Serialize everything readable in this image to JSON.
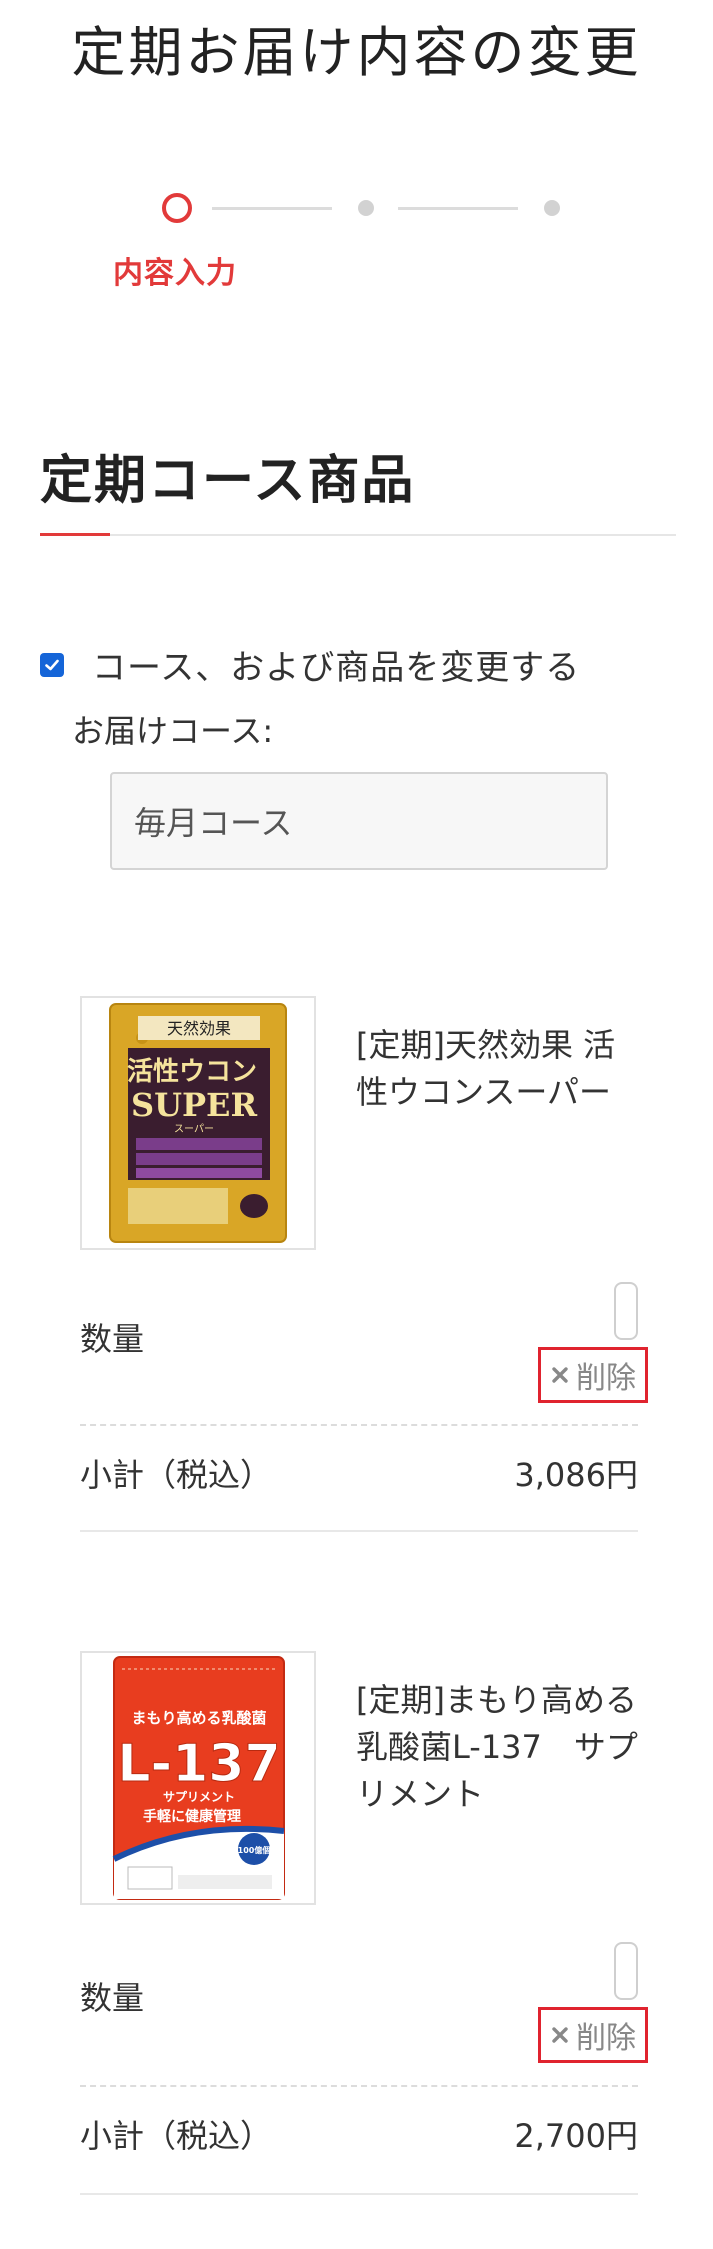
{
  "page": {
    "title": "定期お届け内容の変更"
  },
  "stepper": {
    "current_label": "内容入力"
  },
  "section": {
    "title": "定期コース商品"
  },
  "change": {
    "label": "コース、および商品を変更する",
    "checked": true
  },
  "course": {
    "label": "お届けコース:",
    "value": "毎月コース"
  },
  "products": [
    {
      "name": "[定期]天然効果 活性ウコンスーパー",
      "qty_label": "数量",
      "delete_label": "削除",
      "subtotal_label": "小計（税込）",
      "subtotal_value": "3,086円",
      "package": {
        "brand": "天然効果",
        "title": "活性ウコン",
        "subtitle": "SUPER",
        "kana": "スーパー"
      }
    },
    {
      "name": "[定期]まもり高める乳酸菌L-137　サプリメント",
      "qty_label": "数量",
      "delete_label": "削除",
      "subtotal_label": "小計（税込）",
      "subtotal_value": "2,700円",
      "package": {
        "top": "まもり高める乳酸菌",
        "title": "L-137",
        "subtitle": "サプリメント",
        "tag": "手軽に健康管理",
        "badge": "100億個"
      }
    }
  ],
  "colors": {
    "accent": "#e23a3a",
    "checkbox": "#1565d8",
    "delete_border": "#e0232f"
  }
}
